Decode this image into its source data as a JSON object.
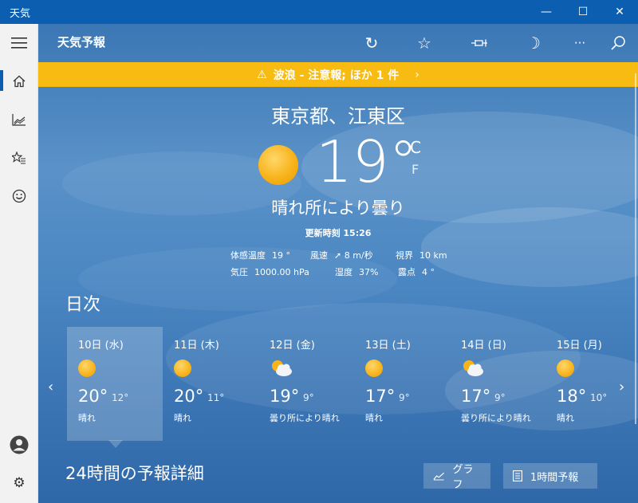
{
  "window": {
    "title": "天気",
    "min": "—",
    "max": "☐",
    "close": "✕"
  },
  "rail": {
    "menu_icon": "hamburger-icon",
    "items": [
      {
        "name": "home",
        "icon": "home-icon",
        "glyph": "⌂"
      },
      {
        "name": "historical",
        "icon": "chart-icon",
        "glyph": "⋯"
      },
      {
        "name": "favorites",
        "icon": "star-list-icon",
        "glyph": "☆"
      },
      {
        "name": "feedback",
        "icon": "smiley-icon",
        "glyph": "☺"
      }
    ],
    "account_icon": "account-icon",
    "settings_icon": "gear-icon",
    "settings_glyph": "⚙"
  },
  "header": {
    "title": "天気予報",
    "refresh_glyph": "↻",
    "favorite_glyph": "☆",
    "pin_glyph": "⊸",
    "theme_glyph": "☽",
    "more_glyph": "···",
    "search_glyph": "⌕"
  },
  "alert": {
    "warn_glyph": "⚠",
    "text": "波浪 - 注意報; ほか 1 件",
    "chevron": "›"
  },
  "current": {
    "location": "東京都、江東区",
    "temperature": "19°",
    "unit_c": "C",
    "unit_f": "F",
    "condition": "晴れ所により曇り",
    "updated": "更新時刻 15:26",
    "details": [
      {
        "label": "体感温度",
        "value": "19 °"
      },
      {
        "label": "風速",
        "value": "➚ 8 m/秒"
      },
      {
        "label": "視界",
        "value": "10 km"
      },
      {
        "label": "気圧",
        "value": "1000.00 hPa"
      },
      {
        "label": "湿度",
        "value": "37%"
      },
      {
        "label": "露点",
        "value": "4 °"
      }
    ]
  },
  "daily": {
    "title": "日次",
    "days": [
      {
        "date": "10日 (水)",
        "icon": "sun-icon",
        "high": "20°",
        "low": "12°",
        "desc": "晴れ"
      },
      {
        "date": "11日 (木)",
        "icon": "sun-icon",
        "high": "20°",
        "low": "11°",
        "desc": "晴れ"
      },
      {
        "date": "12日 (金)",
        "icon": "partly-cloudy-icon",
        "high": "19°",
        "low": "9°",
        "desc": "曇り所により晴れ"
      },
      {
        "date": "13日 (土)",
        "icon": "sun-icon",
        "high": "17°",
        "low": "9°",
        "desc": "晴れ"
      },
      {
        "date": "14日 (日)",
        "icon": "partly-cloudy-icon",
        "high": "17°",
        "low": "9°",
        "desc": "曇り所により晴れ"
      },
      {
        "date": "15日 (月)",
        "icon": "sun-icon",
        "high": "18°",
        "low": "10°",
        "desc": "晴れ"
      }
    ],
    "prev_glyph": "‹",
    "next_glyph": "›"
  },
  "hourly": {
    "title": "24時間の予報詳細",
    "graph_button": "グラフ",
    "hourly_button": "1時間予報"
  }
}
